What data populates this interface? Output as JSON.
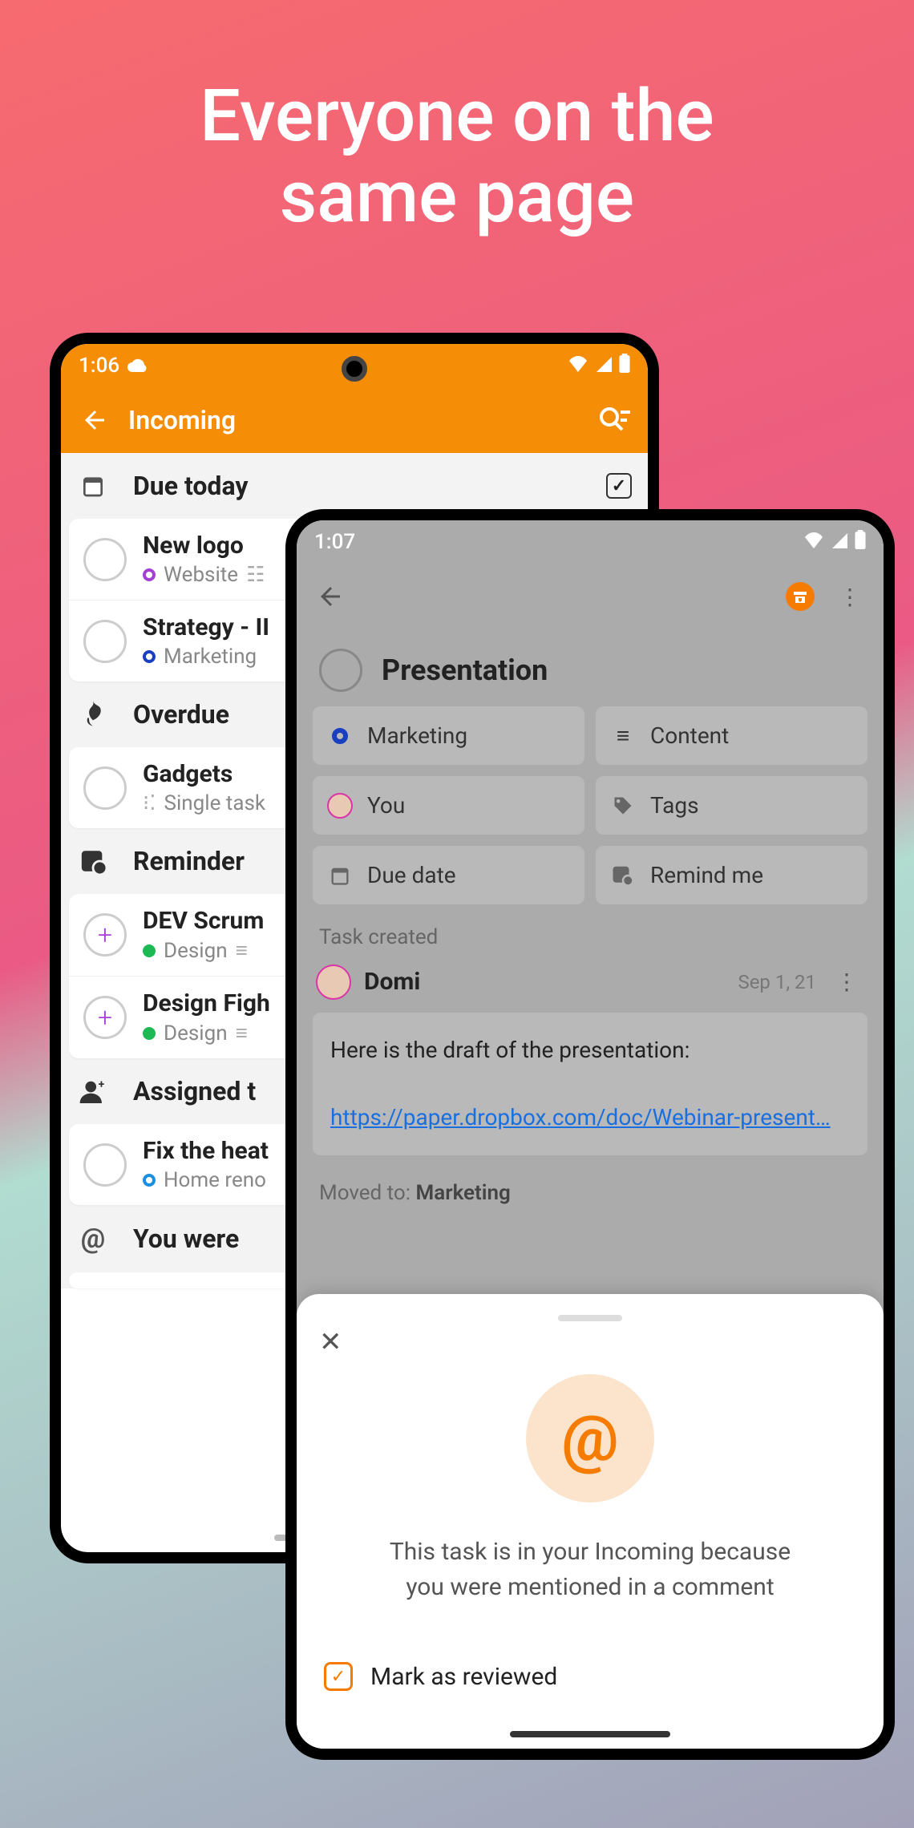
{
  "hero": {
    "line1": "Everyone on the",
    "line2": "same page"
  },
  "back": {
    "status_time": "1:06",
    "appbar_title": "Incoming",
    "sections": {
      "due_today": "Due today",
      "overdue": "Overdue",
      "reminder": "Reminder",
      "assigned": "Assigned t",
      "mentioned": "You were "
    },
    "tasks": {
      "new_logo": {
        "title": "New logo",
        "tag": "Website"
      },
      "strategy": {
        "title": "Strategy - II",
        "tag": "Marketing"
      },
      "gadgets": {
        "title": "Gadgets",
        "tag": "Single task"
      },
      "dev_scrum": {
        "title": "DEV Scrum",
        "tag": "Design"
      },
      "design_fight": {
        "title": "Design Figh",
        "tag": "Design"
      },
      "fix_heat": {
        "title": "Fix the heat",
        "tag": "Home reno"
      }
    }
  },
  "front": {
    "status_time": "1:07",
    "task_title": "Presentation",
    "chips": {
      "project": "Marketing",
      "section": "Content",
      "assignee": "You",
      "tags": "Tags",
      "due": "Due date",
      "remind": "Remind me"
    },
    "task_created": "Task created",
    "comment": {
      "author": "Domi",
      "date": "Sep 1, 21",
      "text": "Here is the draft of the presentation:",
      "link": "https://paper.dropbox.com/doc/Webinar-present…"
    },
    "moved_prefix": "Moved to: ",
    "moved_target": "Marketing",
    "sheet": {
      "message_l1": "This task is in your Incoming because",
      "message_l2": "you were mentioned in a comment",
      "action": "Mark as reviewed"
    }
  }
}
